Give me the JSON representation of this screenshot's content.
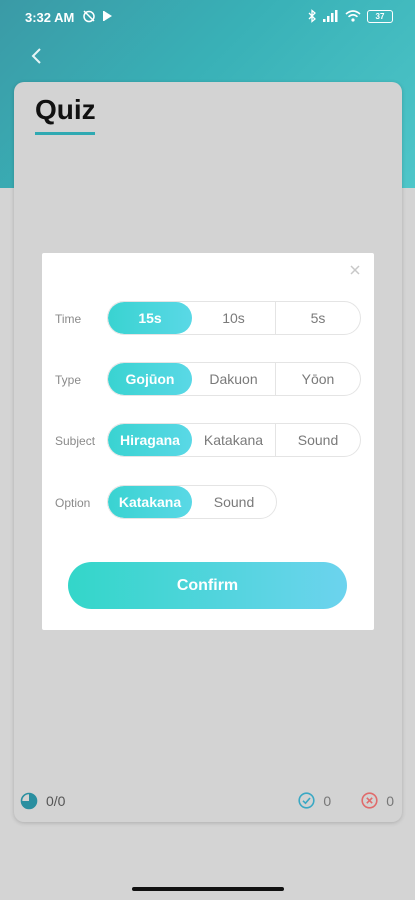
{
  "status_bar": {
    "time": "3:32 AM",
    "battery": "37"
  },
  "header": {
    "title": "Quiz"
  },
  "footer": {
    "progress": "0/0",
    "correct_count": "0",
    "wrong_count": "0"
  },
  "dialog": {
    "rows": [
      {
        "label": "Time",
        "options": [
          "15s",
          "10s",
          "5s"
        ],
        "selected": 0
      },
      {
        "label": "Type",
        "options": [
          "Gojūon",
          "Dakuon",
          "Yōon"
        ],
        "selected": 0
      },
      {
        "label": "Subject",
        "options": [
          "Hiragana",
          "Katakana",
          "Sound"
        ],
        "selected": 0
      },
      {
        "label": "Option",
        "options": [
          "Katakana",
          "Sound"
        ],
        "selected": 0
      }
    ],
    "confirm_label": "Confirm"
  },
  "colors": {
    "accent": "#39d3d1",
    "header": "#3aa8b0"
  }
}
